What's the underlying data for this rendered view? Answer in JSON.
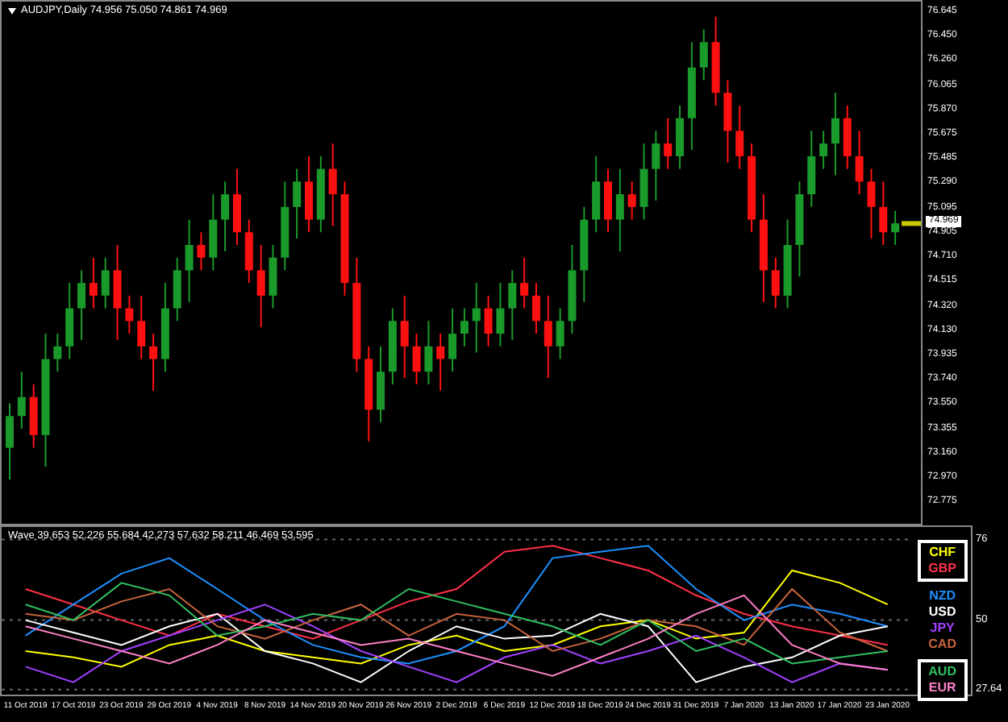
{
  "chart_header": {
    "symbol": "AUDJPY,Daily",
    "ohlc": "74.956 75.050 74.861 74.969"
  },
  "price_chart": {
    "current_price": "74.969",
    "chart_data": {
      "type": "candlestick",
      "ylim": [
        72.6,
        76.72
      ],
      "yticks": [
        {
          "value": 76.645,
          "label": "76.645"
        },
        {
          "value": 76.45,
          "label": "76.450"
        },
        {
          "value": 76.26,
          "label": "76.260"
        },
        {
          "value": 76.065,
          "label": "76.065"
        },
        {
          "value": 75.87,
          "label": "75.870"
        },
        {
          "value": 75.675,
          "label": "75.675"
        },
        {
          "value": 75.485,
          "label": "75.485"
        },
        {
          "value": 75.29,
          "label": "75.290"
        },
        {
          "value": 75.095,
          "label": "75.095"
        },
        {
          "value": 74.905,
          "label": "74.905"
        },
        {
          "value": 74.71,
          "label": "74.710"
        },
        {
          "value": 74.515,
          "label": "74.515"
        },
        {
          "value": 74.32,
          "label": "74.320"
        },
        {
          "value": 74.13,
          "label": "74.130"
        },
        {
          "value": 73.935,
          "label": "73.935"
        },
        {
          "value": 73.74,
          "label": "73.740"
        },
        {
          "value": 73.55,
          "label": "73.550"
        },
        {
          "value": 73.355,
          "label": "73.355"
        },
        {
          "value": 73.16,
          "label": "73.160"
        },
        {
          "value": 72.97,
          "label": "72.970"
        },
        {
          "value": 72.775,
          "label": "72.775"
        }
      ],
      "ohlc": [
        [
          73.2,
          73.55,
          72.95,
          73.45
        ],
        [
          73.45,
          73.8,
          73.35,
          73.6
        ],
        [
          73.6,
          73.7,
          73.2,
          73.3
        ],
        [
          73.3,
          74.1,
          73.05,
          73.9
        ],
        [
          73.9,
          74.1,
          73.8,
          74.0
        ],
        [
          74.0,
          74.5,
          73.9,
          74.3
        ],
        [
          74.3,
          74.6,
          74.05,
          74.5
        ],
        [
          74.5,
          74.7,
          74.3,
          74.4
        ],
        [
          74.4,
          74.7,
          74.3,
          74.6
        ],
        [
          74.6,
          74.8,
          74.05,
          74.3
        ],
        [
          74.3,
          74.4,
          74.1,
          74.2
        ],
        [
          74.2,
          74.4,
          73.9,
          74.0
        ],
        [
          74.0,
          74.1,
          73.65,
          73.9
        ],
        [
          73.9,
          74.5,
          73.8,
          74.3
        ],
        [
          74.3,
          74.7,
          74.2,
          74.6
        ],
        [
          74.6,
          75.0,
          74.35,
          74.8
        ],
        [
          74.8,
          74.9,
          74.6,
          74.7
        ],
        [
          74.7,
          75.2,
          74.6,
          75.0
        ],
        [
          75.0,
          75.3,
          74.75,
          75.2
        ],
        [
          75.2,
          75.4,
          74.8,
          74.9
        ],
        [
          74.9,
          75.0,
          74.5,
          74.6
        ],
        [
          74.6,
          74.8,
          74.15,
          74.4
        ],
        [
          74.4,
          74.8,
          74.3,
          74.7
        ],
        [
          74.7,
          75.3,
          74.6,
          75.1
        ],
        [
          75.1,
          75.4,
          74.85,
          75.3
        ],
        [
          75.3,
          75.5,
          74.9,
          75.0
        ],
        [
          75.0,
          75.5,
          74.9,
          75.4
        ],
        [
          75.4,
          75.6,
          74.95,
          75.2
        ],
        [
          75.2,
          75.3,
          74.4,
          74.5
        ],
        [
          74.5,
          74.7,
          73.8,
          73.9
        ],
        [
          73.9,
          74.0,
          73.25,
          73.5
        ],
        [
          73.5,
          74.0,
          73.4,
          73.8
        ],
        [
          73.8,
          74.3,
          73.7,
          74.2
        ],
        [
          74.2,
          74.4,
          73.75,
          74.0
        ],
        [
          74.0,
          74.1,
          73.7,
          73.8
        ],
        [
          73.8,
          74.2,
          73.7,
          74.0
        ],
        [
          74.0,
          74.1,
          73.65,
          73.9
        ],
        [
          73.9,
          74.3,
          73.8,
          74.1
        ],
        [
          74.1,
          74.3,
          74.0,
          74.2
        ],
        [
          74.2,
          74.5,
          73.95,
          74.3
        ],
        [
          74.3,
          74.4,
          74.0,
          74.1
        ],
        [
          74.1,
          74.5,
          74.0,
          74.3
        ],
        [
          74.3,
          74.6,
          74.05,
          74.5
        ],
        [
          74.5,
          74.7,
          74.3,
          74.4
        ],
        [
          74.4,
          74.5,
          74.1,
          74.2
        ],
        [
          74.2,
          74.4,
          73.75,
          74.0
        ],
        [
          74.0,
          74.3,
          73.9,
          74.2
        ],
        [
          74.2,
          74.8,
          74.1,
          74.6
        ],
        [
          74.6,
          75.1,
          74.35,
          75.0
        ],
        [
          75.0,
          75.5,
          74.9,
          75.3
        ],
        [
          75.3,
          75.4,
          74.9,
          75.0
        ],
        [
          75.0,
          75.4,
          74.75,
          75.2
        ],
        [
          75.2,
          75.3,
          75.0,
          75.1
        ],
        [
          75.1,
          75.6,
          75.0,
          75.4
        ],
        [
          75.4,
          75.7,
          75.15,
          75.6
        ],
        [
          75.6,
          75.8,
          75.4,
          75.5
        ],
        [
          75.5,
          75.9,
          75.4,
          75.8
        ],
        [
          75.8,
          76.4,
          75.55,
          76.2
        ],
        [
          76.2,
          76.5,
          76.1,
          76.4
        ],
        [
          76.4,
          76.6,
          75.9,
          76.0
        ],
        [
          76.0,
          76.1,
          75.45,
          75.7
        ],
        [
          75.7,
          75.9,
          75.4,
          75.5
        ],
        [
          75.5,
          75.6,
          74.9,
          75.0
        ],
        [
          75.0,
          75.2,
          74.35,
          74.6
        ],
        [
          74.6,
          74.7,
          74.3,
          74.4
        ],
        [
          74.4,
          75.0,
          74.3,
          74.8
        ],
        [
          74.8,
          75.3,
          74.55,
          75.2
        ],
        [
          75.2,
          75.7,
          75.1,
          75.5
        ],
        [
          75.5,
          75.7,
          75.4,
          75.6
        ],
        [
          75.6,
          76.0,
          75.35,
          75.8
        ],
        [
          75.8,
          75.9,
          75.4,
          75.5
        ],
        [
          75.5,
          75.7,
          75.2,
          75.3
        ],
        [
          75.3,
          75.4,
          74.85,
          75.1
        ],
        [
          75.1,
          75.3,
          74.8,
          74.9
        ],
        [
          74.9,
          75.07,
          74.8,
          74.97
        ]
      ]
    }
  },
  "indicator": {
    "header": "Wave 39.653 52.226 55.684 42.273 57.632 58.211 46.469 53.595",
    "legend": [
      {
        "boxed": true
      },
      {
        "boxed": true
      },
      {
        "boxed": false
      },
      {
        "boxed": false
      },
      {
        "boxed": false
      },
      {
        "boxed": false
      },
      {
        "boxed": true
      },
      {
        "boxed": true
      }
    ],
    "chart_data": {
      "type": "line",
      "x": [
        "11 Oct 2019",
        "17 Oct 2019",
        "23 Oct 2019",
        "29 Oct 2019",
        "4 Nov 2019",
        "8 Nov 2019",
        "14 Nov 2019",
        "20 Nov 2019",
        "26 Nov 2019",
        "2 Dec 2019",
        "6 Dec 2019",
        "12 Dec 2019",
        "18 Dec 2019",
        "24 Dec 2019",
        "31 Dec 2019",
        "7 Jan 2020",
        "13 Jan 2020",
        "17 Jan 2020",
        "23 Jan 2020"
      ],
      "ylim": [
        26,
        80
      ],
      "grid": true,
      "yticks": [
        {
          "value": 76,
          "label": "76"
        },
        {
          "value": 50,
          "label": "50"
        },
        {
          "value": 27.64,
          "label": "27.64"
        }
      ],
      "series": [
        {
          "name": "CHF",
          "color": "#ffff00",
          "values": [
            40,
            38,
            35,
            42,
            45,
            40,
            38,
            36,
            42,
            45,
            40,
            42,
            48,
            50,
            44,
            46,
            66,
            62,
            55
          ]
        },
        {
          "name": "GBP",
          "color": "#ff3048",
          "values": [
            60,
            55,
            50,
            45,
            52,
            48,
            44,
            50,
            56,
            60,
            72,
            74,
            70,
            66,
            58,
            52,
            48,
            45,
            42
          ]
        },
        {
          "name": "NZD",
          "color": "#1e90ff",
          "values": [
            45,
            55,
            65,
            70,
            60,
            50,
            42,
            38,
            36,
            40,
            48,
            70,
            72,
            74,
            60,
            50,
            55,
            52,
            48
          ]
        },
        {
          "name": "USD",
          "color": "#ffffff",
          "values": [
            50,
            46,
            42,
            48,
            52,
            40,
            36,
            30,
            40,
            48,
            44,
            45,
            52,
            48,
            30,
            35,
            38,
            45,
            48
          ]
        },
        {
          "name": "JPY",
          "color": "#a040ff",
          "values": [
            35,
            30,
            40,
            45,
            50,
            55,
            48,
            40,
            35,
            30,
            38,
            42,
            36,
            40,
            45,
            38,
            30,
            36,
            34
          ]
        },
        {
          "name": "CAD",
          "color": "#c8643c",
          "values": [
            52,
            50,
            56,
            60,
            48,
            44,
            50,
            55,
            45,
            52,
            50,
            40,
            44,
            50,
            48,
            42,
            60,
            46,
            40
          ]
        },
        {
          "name": "AUD",
          "color": "#30c060",
          "values": [
            55,
            50,
            62,
            58,
            45,
            48,
            52,
            50,
            60,
            56,
            52,
            48,
            42,
            50,
            40,
            44,
            36,
            38,
            40
          ]
        },
        {
          "name": "EUR",
          "color": "#ff80c8",
          "values": [
            48,
            44,
            40,
            36,
            42,
            50,
            46,
            42,
            44,
            40,
            36,
            32,
            38,
            44,
            52,
            58,
            42,
            36,
            34
          ]
        }
      ]
    }
  }
}
